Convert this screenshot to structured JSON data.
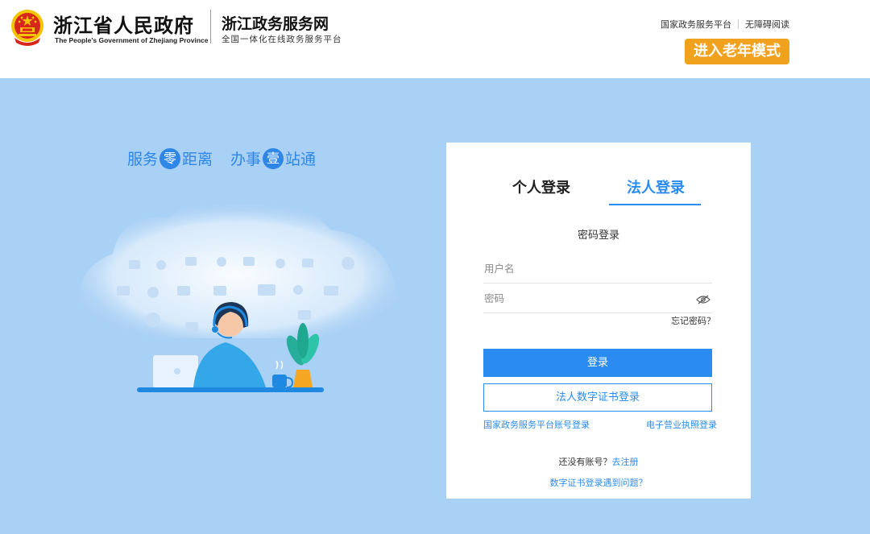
{
  "header": {
    "gov_title": "浙江省人民政府",
    "gov_subtitle": "The People's Government of Zhejiang Province",
    "site_title": "浙江政务服务网",
    "site_subtitle": "全国一体化在线政务服务平台",
    "top_links": [
      "国家政务服务平台",
      "无障碍阅读"
    ],
    "elder_mode_label": "进入老年模式"
  },
  "hero": {
    "slogan_part1_a": "服务",
    "slogan_part1_bubble": "零",
    "slogan_part1_b": "距离",
    "slogan_part2_a": "办事",
    "slogan_part2_bubble": "壹",
    "slogan_part2_b": "站通"
  },
  "login": {
    "tabs": [
      {
        "label": "个人登录",
        "active": false
      },
      {
        "label": "法人登录",
        "active": true
      }
    ],
    "mode_title": "密码登录",
    "username_placeholder": "用户名",
    "password_placeholder": "密码",
    "forgot_password": "忘记密码？",
    "login_button": "登录",
    "cert_login_button": "法人数字证书登录",
    "national_platform_login": "国家政务服务平台账号登录",
    "business_license_login": "电子营业执照登录",
    "no_account_prefix": "还没有账号？",
    "register_link": "去注册",
    "cert_problem_link": "数字证书登录遇到问题？"
  },
  "colors": {
    "accent": "#2a8cf0",
    "background": "#a9d0f5",
    "elder_button": "#f0a11d",
    "emblem_red": "#d7261c",
    "emblem_gold": "#f5c400"
  },
  "icons": {
    "emblem": "national-emblem-icon",
    "eye": "eye-icon"
  }
}
